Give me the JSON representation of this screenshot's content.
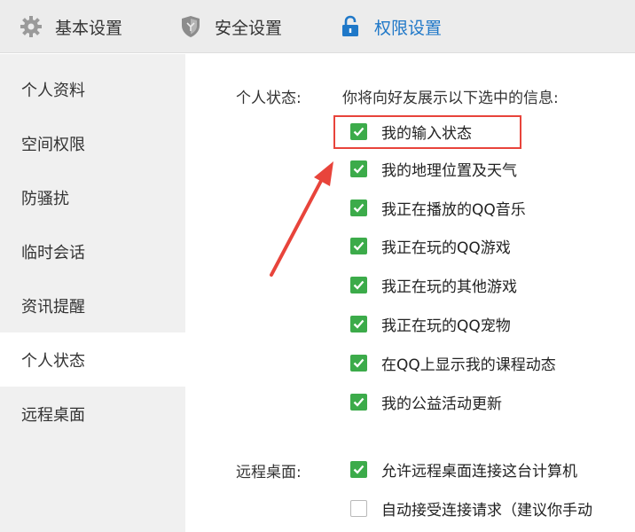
{
  "topbar": {
    "tabs": [
      {
        "label": "基本设置",
        "icon": "gear-icon"
      },
      {
        "label": "安全设置",
        "icon": "shield-icon"
      },
      {
        "label": "权限设置",
        "icon": "lock-icon",
        "active": true
      }
    ]
  },
  "sidebar": {
    "items": [
      {
        "label": "个人资料"
      },
      {
        "label": "空间权限"
      },
      {
        "label": "防骚扰"
      },
      {
        "label": "临时会话"
      },
      {
        "label": "资讯提醒"
      },
      {
        "label": "个人状态",
        "active": true
      },
      {
        "label": "远程桌面"
      }
    ]
  },
  "personal_status": {
    "label": "个人状态:",
    "description": "你将向好友展示以下选中的信息:",
    "options": [
      {
        "label": "我的输入状态",
        "checked": true
      },
      {
        "label": "我的地理位置及天气",
        "checked": true
      },
      {
        "label": "我正在播放的QQ音乐",
        "checked": true
      },
      {
        "label": "我正在玩的QQ游戏",
        "checked": true
      },
      {
        "label": "我正在玩的其他游戏",
        "checked": true
      },
      {
        "label": "我正在玩的QQ宠物",
        "checked": true
      },
      {
        "label": "在QQ上显示我的课程动态",
        "checked": true
      },
      {
        "label": "我的公益活动更新",
        "checked": true
      }
    ]
  },
  "remote_desktop": {
    "label": "远程桌面:",
    "options": [
      {
        "label": "允许远程桌面连接这台计算机",
        "checked": true
      },
      {
        "label": "自动接受连接请求（建议你手动",
        "checked": false
      }
    ]
  },
  "colors": {
    "accent": "#1f78c8",
    "checkbox_green": "#3cab4a",
    "annotation_red": "#e8443b"
  }
}
